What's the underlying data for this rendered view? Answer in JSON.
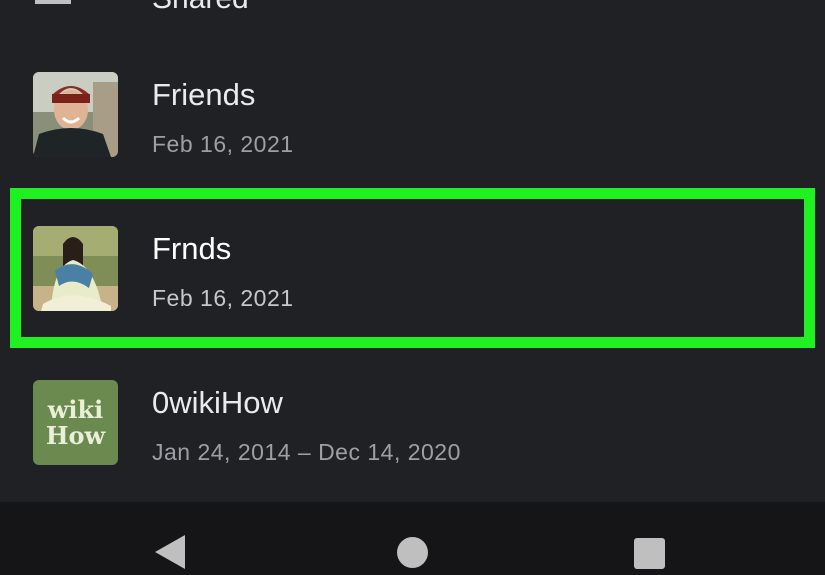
{
  "top_row": {
    "label": "Shared",
    "icon": "shared-album-icon"
  },
  "albums": [
    {
      "title": "Friends",
      "date": "Feb 16, 2021",
      "thumb": "person-photo"
    },
    {
      "title": "Frnds",
      "date": "Feb 16, 2021",
      "thumb": "person-photo",
      "highlighted": true
    },
    {
      "title": "0wikiHow",
      "date": "Jan 24, 2014 – Dec 14, 2020",
      "thumb": "wikihow-logo",
      "logo_line1": "wiki",
      "logo_line2": "How"
    }
  ],
  "nav": {
    "back_icon": "back-triangle-icon",
    "home_icon": "home-circle-icon",
    "recents_icon": "recents-square-icon"
  },
  "colors": {
    "background": "#202124",
    "highlight": "#1ff01f",
    "nav_background": "#151517"
  }
}
